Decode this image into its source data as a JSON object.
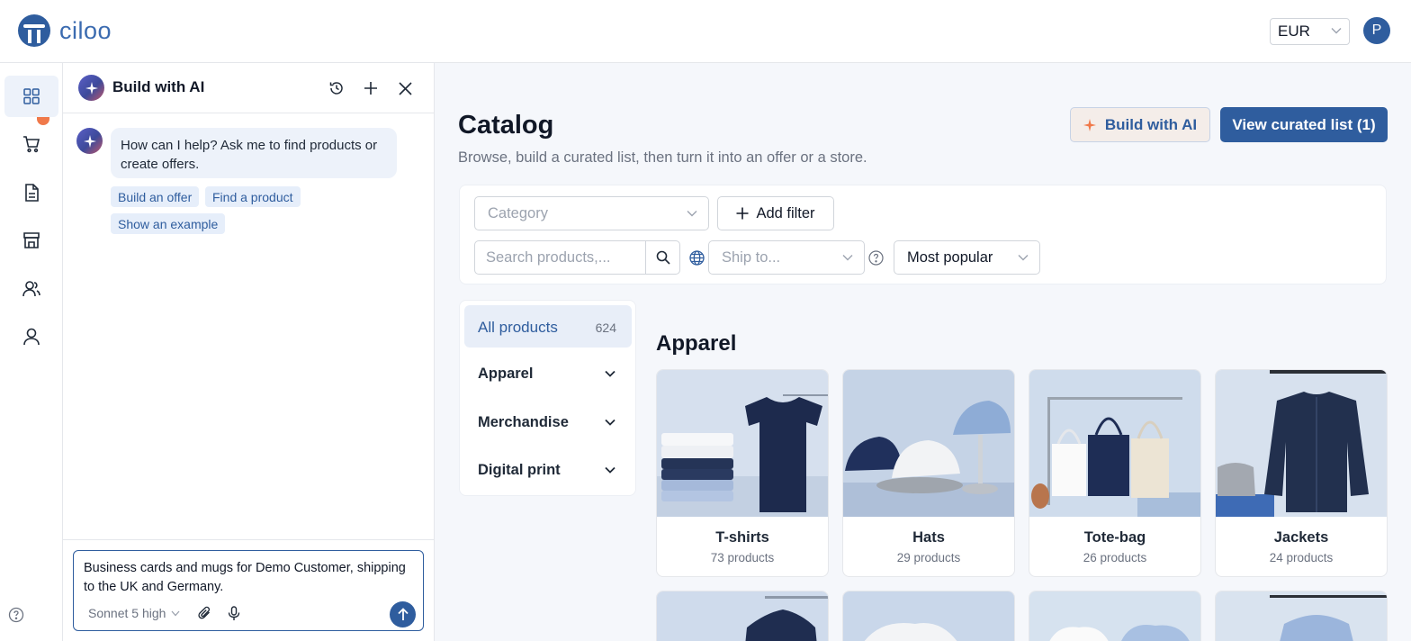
{
  "brand": {
    "name": "ciloo"
  },
  "topbar": {
    "currency": "EUR",
    "avatar_initial": "P"
  },
  "rail": {
    "items": [
      {
        "icon": "grid-icon",
        "active": true
      },
      {
        "icon": "cart-icon",
        "active": false
      },
      {
        "icon": "document-icon",
        "active": false
      },
      {
        "icon": "store-icon",
        "active": false
      },
      {
        "icon": "users-icon",
        "active": false
      },
      {
        "icon": "user-icon",
        "active": false
      }
    ],
    "help_icon": "help-icon"
  },
  "ai_panel": {
    "title": "Build with AI",
    "assistant_message": "How can I help? Ask me to find products or create offers.",
    "chips": [
      "Build an offer",
      "Find a product",
      "Show an example"
    ],
    "composer_text": "Business cards and mugs for Demo Customer, shipping to the UK and Germany.",
    "model": "Sonnet 5 high"
  },
  "main": {
    "title": "Catalog",
    "subtitle": "Browse, build a curated list, then turn it into an offer or a store.",
    "build_ai_label": "Build with AI",
    "view_list_label": "View curated list (1)",
    "filters": {
      "category_placeholder": "Category",
      "add_filter_label": "Add filter",
      "search_placeholder": "Search products,...",
      "ship_placeholder": "Ship to...",
      "sort_value": "Most popular"
    },
    "categories": {
      "all_label": "All products",
      "all_count": "624",
      "groups": [
        "Apparel",
        "Merchandise",
        "Digital print"
      ]
    },
    "section_title": "Apparel",
    "tiles": [
      {
        "name": "T-shirts",
        "count": "73 products"
      },
      {
        "name": "Hats",
        "count": "29 products"
      },
      {
        "name": "Tote-bag",
        "count": "26 products"
      },
      {
        "name": "Jackets",
        "count": "24 products"
      }
    ]
  },
  "colors": {
    "accent": "#2f5d9e",
    "notification": "#f0794a"
  }
}
